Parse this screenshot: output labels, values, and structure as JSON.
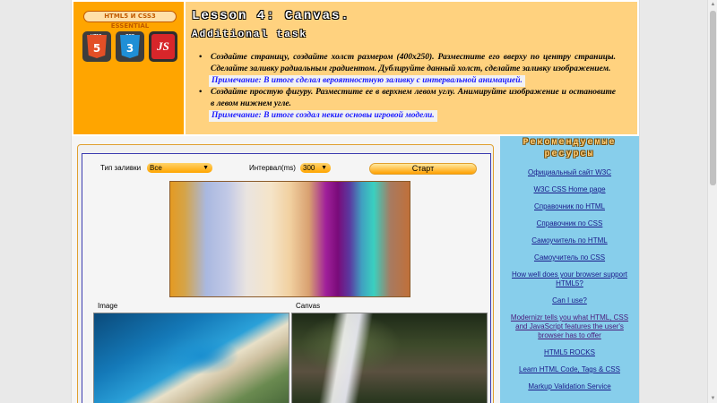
{
  "header": {
    "badge": "HTML5 И CSS3 ESSENTIAL",
    "logos": [
      {
        "icon": "html5-logo",
        "text": "5",
        "small": "HTML"
      },
      {
        "icon": "css3-logo",
        "text": "3",
        "small": "CSS"
      },
      {
        "icon": "js-logo",
        "text": "JS"
      }
    ],
    "title": "Lesson 4: Canvas.",
    "subtitle": "Additional task",
    "tasks": [
      {
        "text": "Создайте страницу, создайте холст размером (400x250). Разместите его вверху по центру страницы. Сделайте заливку радиальным градиентом. Дублируйте данный холст, сделайте заливку изображением.",
        "note": "Примечание: В итоге сделал вероятностную заливку с интервальной анимацией."
      },
      {
        "text": "Создайте простую фигуру. Разместите ее в верхнем левом углу. Анимируйте изображение и остановите в левом нижнем угле.",
        "note": "Примечание: В итоге создал некие основы игровой модели."
      }
    ]
  },
  "controls": {
    "fill_type_label": "Тип заливки",
    "fill_type_value": "Все",
    "interval_label": "Интервал(ms)",
    "interval_value": "300",
    "start_button": "Старт"
  },
  "images": {
    "image_label": "Image",
    "canvas_label": "Canvas"
  },
  "sidebar": {
    "title": "Рекомендуемые ресурсы",
    "links": [
      "Официальный сайт W3C",
      "W3C CSS Home page",
      "Справочник по HTML",
      "Справочник по CSS",
      "Самоучитель по HTML",
      "Самоучитель по CSS",
      "How well does your browser support HTML5?",
      "Can I use?",
      "Modernizr tells you what HTML, CSS and JavaScript features the user's browser has to offer",
      "HTML5 ROCKS",
      "Learn HTML Code, Tags & CSS",
      "Markup Validation Service"
    ]
  },
  "colors": {
    "header_left": "#ffa500",
    "header_right": "#ffd27f",
    "sidebar": "#87ceeb",
    "note_text": "#1a1aff"
  }
}
